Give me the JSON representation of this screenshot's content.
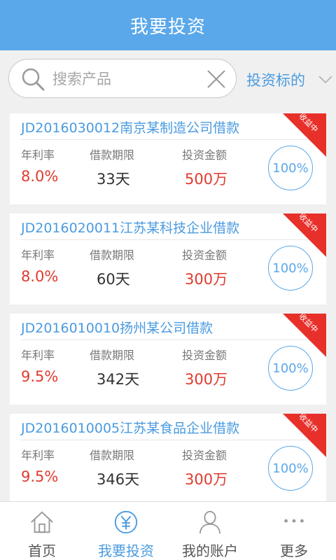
{
  "header": {
    "title": "我要投资"
  },
  "search": {
    "placeholder": "搜索产品",
    "value": ""
  },
  "filter": {
    "label": "投资标的"
  },
  "labels": {
    "rate": "年利率",
    "period": "借款期限",
    "amount": "投资金额"
  },
  "products": [
    {
      "title": "JD2016030012南京某制造公司借款",
      "status": "收益中",
      "rate": "8.0%",
      "period": "33天",
      "amount": "500万",
      "progress": "100%"
    },
    {
      "title": "JD2016020011江苏某科技企业借款",
      "status": "收益中",
      "rate": "8.0%",
      "period": "60天",
      "amount": "300万",
      "progress": "100%"
    },
    {
      "title": "JD2016010010扬州某公司借款",
      "status": "收益中",
      "rate": "9.5%",
      "period": "342天",
      "amount": "300万",
      "progress": "100%"
    },
    {
      "title": "JD2016010005江苏某食品企业借款",
      "status": "收益中",
      "rate": "9.5%",
      "period": "346天",
      "amount": "300万",
      "progress": "100%"
    }
  ],
  "tabs": [
    {
      "label": "首页",
      "icon": "home-icon"
    },
    {
      "label": "我要投资",
      "icon": "yuan-icon",
      "active": true
    },
    {
      "label": "我的账户",
      "icon": "user-icon"
    },
    {
      "label": "更多",
      "icon": "more-icon"
    }
  ],
  "colors": {
    "primary": "#5aa8ea",
    "accent_red": "#e03a2e"
  }
}
